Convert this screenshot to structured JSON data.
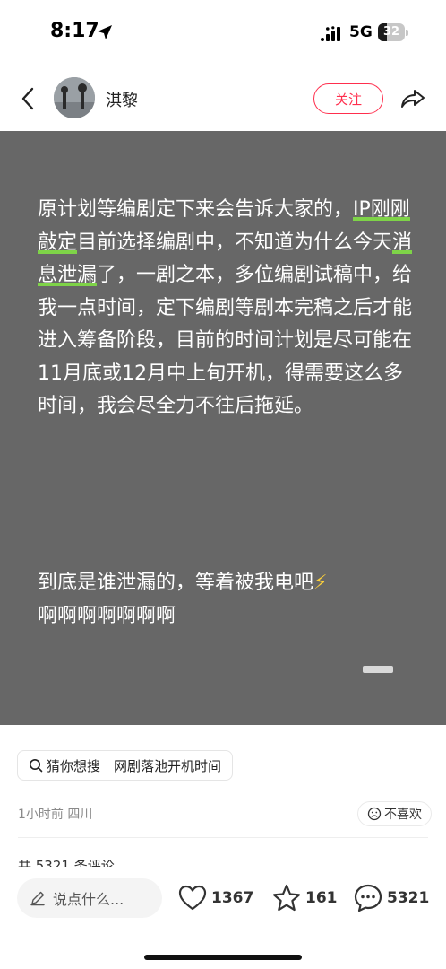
{
  "status": {
    "time": "8:17",
    "network": "5G",
    "battery": "32",
    "battery_level": 0.32
  },
  "header": {
    "username": "淇黎",
    "follow_label": "关注"
  },
  "post": {
    "paragraph1": {
      "p1_hl1": "IP刚刚敲定",
      "p1_t1": "原计划等编剧定下来会告诉大家的，",
      "p1_t2": "目前选择编剧中，不知道为什么今天",
      "p1_hl2": "消息泄漏",
      "p1_t3": "了，一剧之本，多位编剧试稿中，给我一点时间，定下编剧等剧本完稿之后才能进入筹备阶段，目前的时间计划是尽可能在11月底或12月中上旬开机，得需要这么多时间，我会尽全力不往后拖延。"
    },
    "paragraph2": {
      "text": "到底是谁泄漏的，等着被我电吧",
      "emoji": "⚡",
      "text2": "啊啊啊啊啊啊啊"
    }
  },
  "search_tag": {
    "prefix": "猜你想搜",
    "query": "网剧落池开机时间"
  },
  "meta": {
    "time_location": "1小时前 四川",
    "dislike_label": "不喜欢"
  },
  "comments_header": "共 5321 条评论",
  "bottom_bar": {
    "comment_placeholder": "说点什么...",
    "likes": "1367",
    "favorites": "161",
    "comments": "5321"
  }
}
